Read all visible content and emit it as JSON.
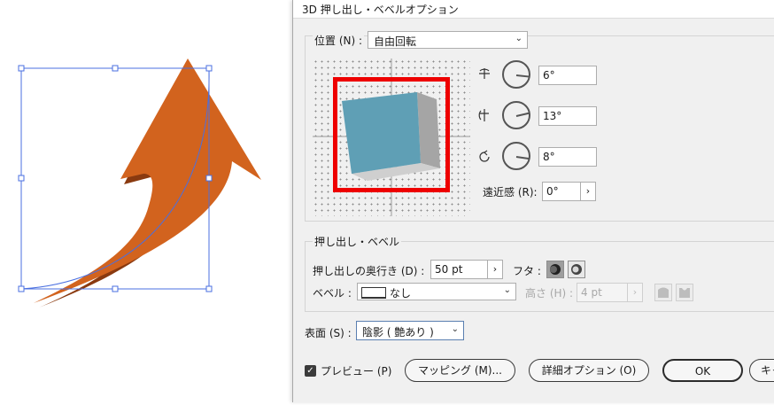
{
  "dialog": {
    "title": "3D 押し出し・ベベルオプション"
  },
  "position": {
    "label": "位置 (N) :",
    "selected": "自由回転",
    "rotations": [
      {
        "value": "6°",
        "angle": 6
      },
      {
        "value": "13°",
        "angle": 13
      },
      {
        "value": "8°",
        "angle": 8
      }
    ],
    "perspective_label": "遠近感 (R):",
    "perspective_value": "0°"
  },
  "extrude": {
    "section_label": "押し出し・ベベル",
    "depth_label": "押し出しの奥行き (D) :",
    "depth_value": "50 pt",
    "cap_label": "フタ :",
    "bevel_label": "ベベル :",
    "bevel_value": "なし",
    "height_label": "高さ (H) :",
    "height_value": "4 pt"
  },
  "surface": {
    "label": "表面 (S) :",
    "value": "陰影 ( 艶あり )"
  },
  "footer": {
    "preview_label": "プレビュー (P)",
    "preview_checked": "✓",
    "mapping_label": "マッピング (M)...",
    "detail_label": "詳細オプション (O)",
    "ok_label": "OK",
    "cancel_label": "キャ"
  },
  "colors": {
    "arrow_front": "#d2631e",
    "arrow_side": "#8a3a10",
    "cube_front": "#5f9fb5",
    "cube_side": "#a5a5a5",
    "highlight_box": "#ee0000",
    "selection": "#4a6fe0"
  }
}
